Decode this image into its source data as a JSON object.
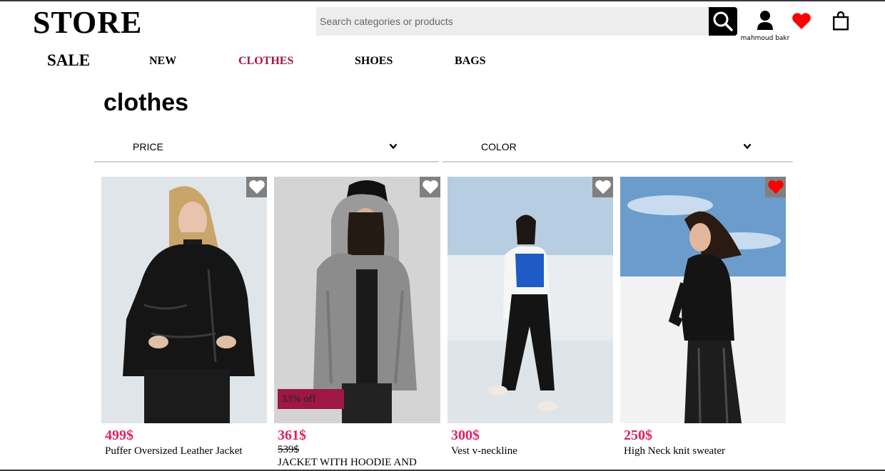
{
  "header": {
    "logo": "STORE",
    "search_placeholder": "Search categories or products",
    "user_name": "mahmoud bakr"
  },
  "nav": {
    "sale": "SALE",
    "new": "NEW",
    "clothes": "CLOTHES",
    "shoes": "SHOES",
    "bags": "BAGS",
    "active": "CLOTHES"
  },
  "page": {
    "title": "clothes"
  },
  "filters": {
    "price": "PRICE",
    "color": "COLOR"
  },
  "colors": {
    "accent": "#9e1747",
    "price": "#e0245e",
    "favorite_active": "#ff0000"
  },
  "products": [
    {
      "price": "499$",
      "name": "Puffer Oversized Leather Jacket",
      "favorite": false
    },
    {
      "price": "361$",
      "old_price": "539$",
      "badge": "33% off",
      "name": "JACKET WITH HOODIE AND",
      "favorite": false
    },
    {
      "price": "300$",
      "name": "Vest v-neckline",
      "favorite": false
    },
    {
      "price": "250$",
      "name": "High Neck knit sweater",
      "favorite": true
    }
  ],
  "icons": [
    "search-icon",
    "user-icon",
    "heart-icon",
    "shopping-bag-icon",
    "chevron-down-icon"
  ]
}
